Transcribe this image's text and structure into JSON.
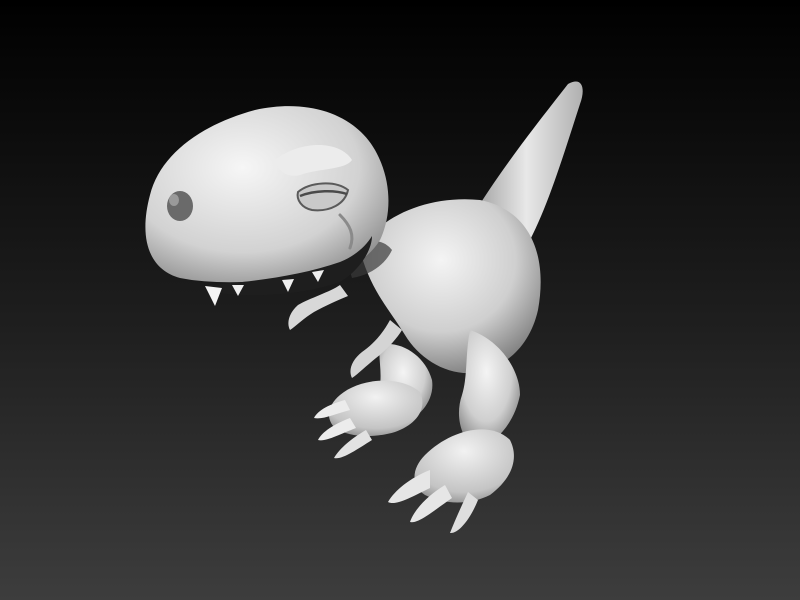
{
  "scene": {
    "subject_icon": "dinosaur-sculpt",
    "colors": {
      "background_top": "#000000",
      "background_bottom": "#3d3d3d",
      "clay_light": "#f2f2f2",
      "clay_mid": "#b8b8b8",
      "clay_dark": "#4a4a4a",
      "shadow": "#151515"
    }
  }
}
